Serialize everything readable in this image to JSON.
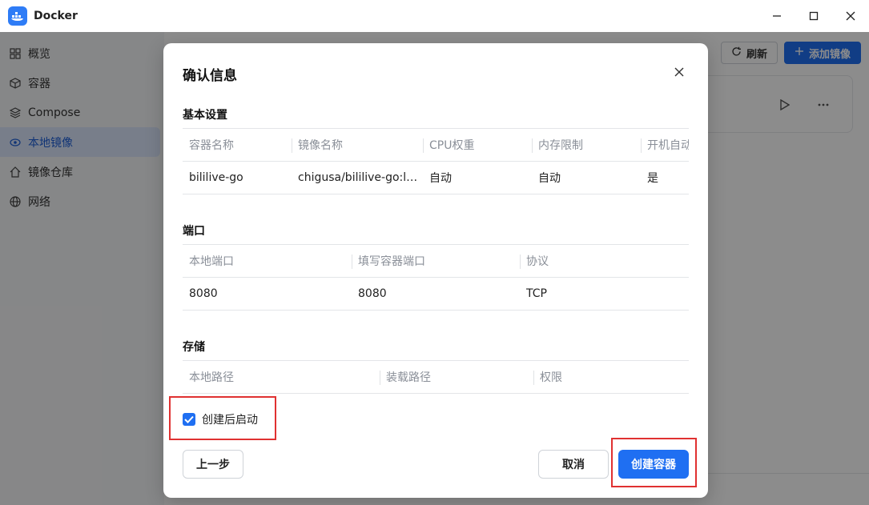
{
  "app": {
    "title": "Docker"
  },
  "sidebar": {
    "items": [
      {
        "label": "概览",
        "icon": "grid-icon"
      },
      {
        "label": "容器",
        "icon": "cube-icon"
      },
      {
        "label": "Compose",
        "icon": "layers-icon"
      },
      {
        "label": "本地镜像",
        "icon": "eye-icon",
        "active": true
      },
      {
        "label": "镜像仓库",
        "icon": "home-icon"
      },
      {
        "label": "网络",
        "icon": "globe-icon"
      }
    ]
  },
  "toolbar": {
    "refresh_label": "刷新",
    "add_image_label": "添加镜像"
  },
  "modal": {
    "title": "确认信息",
    "basic": {
      "title": "基本设置",
      "columns": [
        "容器名称",
        "镜像名称",
        "CPU权重",
        "内存限制",
        "开机自动"
      ],
      "row": [
        "bililive-go",
        "chigusa/bililive-go:la…",
        "自动",
        "自动",
        "是"
      ]
    },
    "ports": {
      "title": "端口",
      "columns": [
        "本地端口",
        "填写容器端口",
        "协议"
      ],
      "row": [
        "8080",
        "8080",
        "TCP"
      ]
    },
    "storage": {
      "title": "存储",
      "columns": [
        "本地路径",
        "装载路径",
        "权限"
      ]
    },
    "start_after_create": {
      "label": "创建后启动",
      "checked": true
    },
    "prev_label": "上一步",
    "cancel_label": "取消",
    "create_label": "创建容器"
  },
  "colors": {
    "accent": "#1f6ff2",
    "highlight": "#e03131"
  }
}
